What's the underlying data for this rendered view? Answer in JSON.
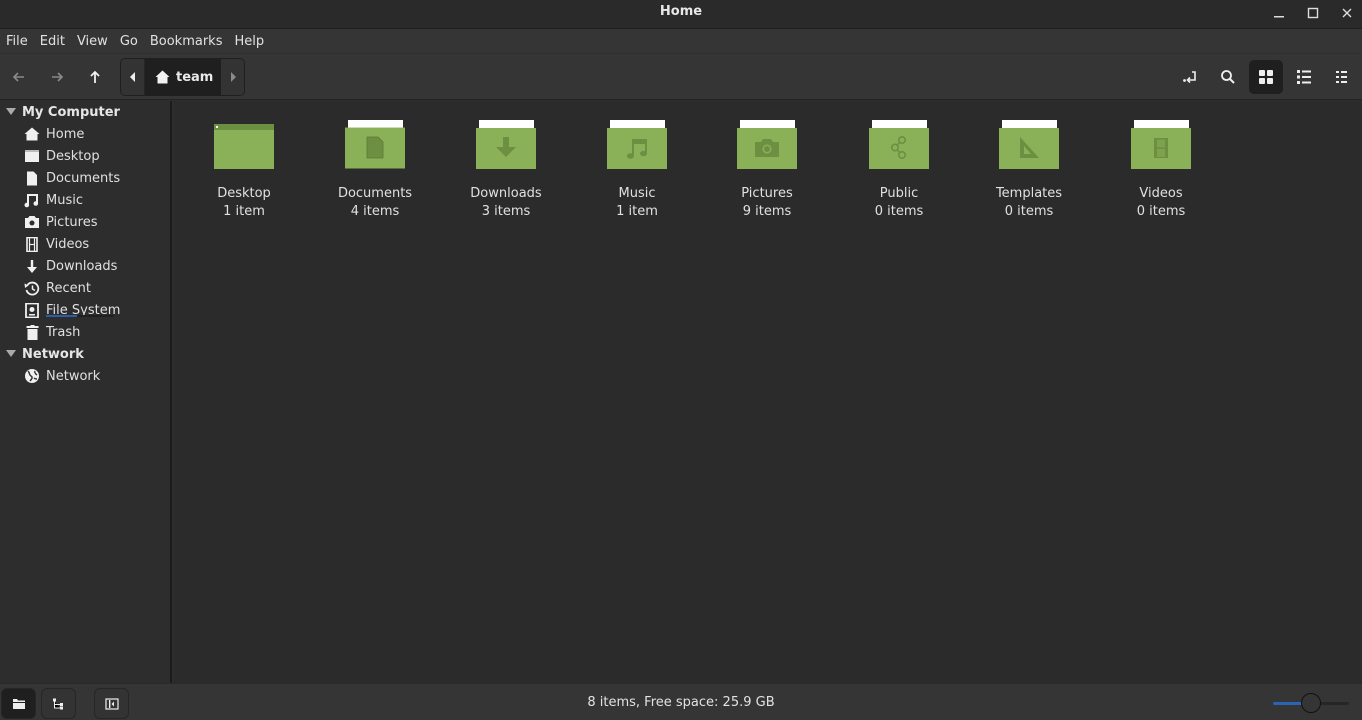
{
  "window": {
    "title": "Home"
  },
  "menubar": [
    "File",
    "Edit",
    "View",
    "Go",
    "Bookmarks",
    "Help"
  ],
  "pathbar": {
    "current": "team",
    "icon": "home-icon"
  },
  "sidebar": {
    "sections": [
      {
        "title": "My Computer",
        "items": [
          {
            "label": "Home",
            "icon": "home-icon"
          },
          {
            "label": "Desktop",
            "icon": "desktop-icon"
          },
          {
            "label": "Documents",
            "icon": "document-icon"
          },
          {
            "label": "Music",
            "icon": "music-icon"
          },
          {
            "label": "Pictures",
            "icon": "camera-icon"
          },
          {
            "label": "Videos",
            "icon": "film-icon"
          },
          {
            "label": "Downloads",
            "icon": "download-icon"
          },
          {
            "label": "Recent",
            "icon": "history-icon"
          },
          {
            "label": "File System",
            "icon": "drive-icon",
            "usage_fraction": 0.45
          },
          {
            "label": "Trash",
            "icon": "trash-icon"
          }
        ]
      },
      {
        "title": "Network",
        "items": [
          {
            "label": "Network",
            "icon": "globe-icon"
          }
        ]
      }
    ]
  },
  "files": [
    {
      "name": "Desktop",
      "count": "1 item",
      "emblem": "desktop"
    },
    {
      "name": "Documents",
      "count": "4 items",
      "emblem": "document"
    },
    {
      "name": "Downloads",
      "count": "3 items",
      "emblem": "download"
    },
    {
      "name": "Music",
      "count": "1 item",
      "emblem": "music"
    },
    {
      "name": "Pictures",
      "count": "9 items",
      "emblem": "camera"
    },
    {
      "name": "Public",
      "count": "0 items",
      "emblem": "share"
    },
    {
      "name": "Templates",
      "count": "0 items",
      "emblem": "template"
    },
    {
      "name": "Videos",
      "count": "0 items",
      "emblem": "film"
    }
  ],
  "statusbar": {
    "text": "8 items, Free space: 25.9 GB",
    "zoom_fraction": 0.5
  },
  "colors": {
    "folder": "#8bb158",
    "folder_emblem": "#6c8f42",
    "accent": "#2a64b4"
  }
}
